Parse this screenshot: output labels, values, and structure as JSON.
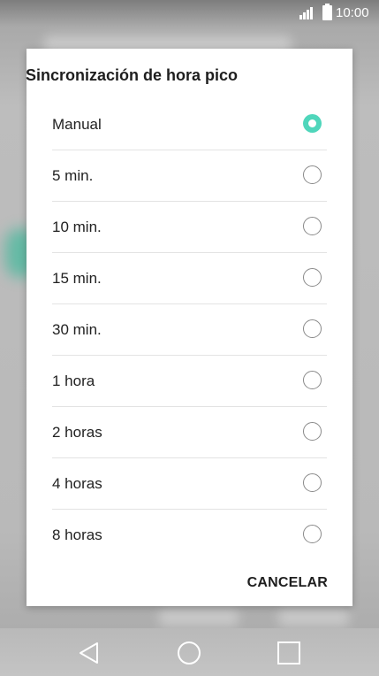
{
  "status_bar": {
    "time": "10:00"
  },
  "dialog": {
    "title": "Sincronización de hora pico",
    "options": [
      {
        "label": "Manual",
        "selected": true
      },
      {
        "label": "5 min.",
        "selected": false
      },
      {
        "label": "10 min.",
        "selected": false
      },
      {
        "label": "15 min.",
        "selected": false
      },
      {
        "label": "30 min.",
        "selected": false
      },
      {
        "label": "1 hora",
        "selected": false
      },
      {
        "label": "2 horas",
        "selected": false
      },
      {
        "label": "4 horas",
        "selected": false
      },
      {
        "label": "8 horas",
        "selected": false
      }
    ],
    "cancel_label": "CANCELAR",
    "accent_color": "#4fd6bb"
  },
  "nav_bar": {
    "icons": [
      "back-icon",
      "home-icon",
      "recents-icon"
    ]
  }
}
